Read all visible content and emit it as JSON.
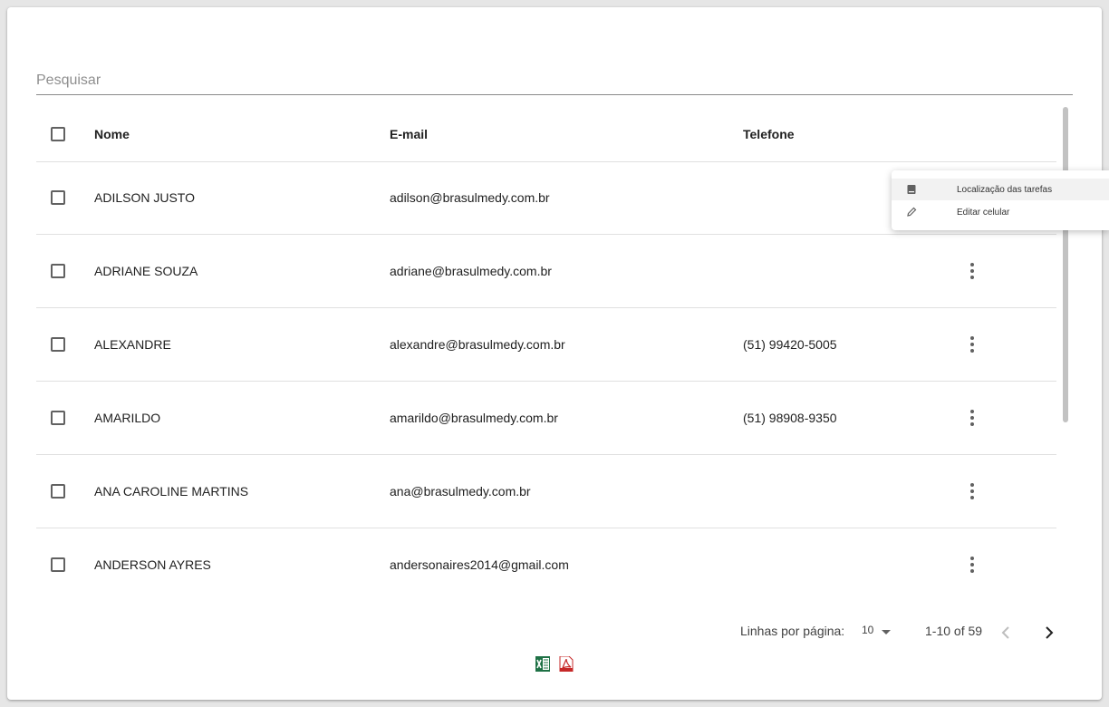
{
  "search": {
    "placeholder": "Pesquisar"
  },
  "table": {
    "headers": {
      "nome": "Nome",
      "email": "E-mail",
      "telefone": "Telefone"
    },
    "rows": [
      {
        "nome": "ADILSON JUSTO",
        "email": "adilson@brasulmedy.com.br",
        "telefone": ""
      },
      {
        "nome": "ADRIANE SOUZA",
        "email": "adriane@brasulmedy.com.br",
        "telefone": ""
      },
      {
        "nome": "ALEXANDRE",
        "email": "alexandre@brasulmedy.com.br",
        "telefone": "(51) 99420-5005"
      },
      {
        "nome": "AMARILDO",
        "email": "amarildo@brasulmedy.com.br",
        "telefone": "(51) 98908-9350"
      },
      {
        "nome": "ANA CAROLINE MARTINS",
        "email": "ana@brasulmedy.com.br",
        "telefone": ""
      },
      {
        "nome": "ANDERSON AYRES",
        "email": "andersonaires2014@gmail.com",
        "telefone": ""
      }
    ]
  },
  "menu": {
    "items": [
      {
        "label": "Localização das tarefas",
        "icon": "book-icon"
      },
      {
        "label": "Editar celular",
        "icon": "pencil-icon"
      }
    ]
  },
  "pagination": {
    "rows_per_page_label": "Linhas por página:",
    "rows_per_page_value": "10",
    "range": "1-10 of 59"
  },
  "export": {
    "excel_icon": "excel-icon",
    "pdf_icon": "pdf-icon"
  }
}
